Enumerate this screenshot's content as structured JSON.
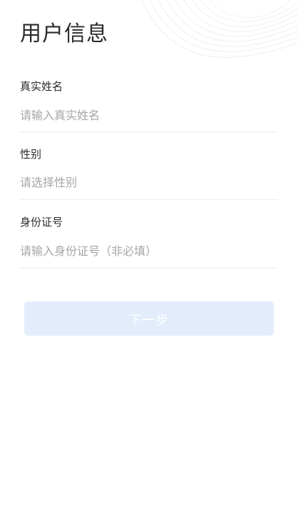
{
  "page": {
    "title": "用户信息"
  },
  "form": {
    "real_name": {
      "label": "真实姓名",
      "placeholder": "请输入真实姓名",
      "value": ""
    },
    "gender": {
      "label": "性别",
      "placeholder": "请选择性别"
    },
    "id_number": {
      "label": "身份证号",
      "placeholder": "请输入身份证号（非必填）",
      "value": ""
    }
  },
  "actions": {
    "next_label": "下一步"
  },
  "colors": {
    "button_background": "#e3ecfb",
    "button_text": "#ffffff",
    "placeholder": "#a6a6a6",
    "divider": "#ececec"
  }
}
